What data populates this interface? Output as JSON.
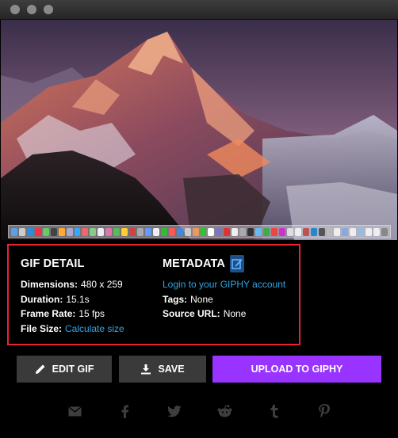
{
  "window": {
    "title": ""
  },
  "gif_detail": {
    "title": "GIF DETAIL",
    "dimensions_label": "Dimensions:",
    "dimensions_value": "480 x 259",
    "duration_label": "Duration:",
    "duration_value": "15.1s",
    "frame_rate_label": "Frame Rate:",
    "frame_rate_value": "15 fps",
    "file_size_label": "File Size:",
    "file_size_link": "Calculate size"
  },
  "metadata": {
    "title": "METADATA",
    "edit_icon": "edit-icon",
    "login_link": "Login to your GIPHY account",
    "tags_label": "Tags:",
    "tags_value": "None",
    "source_label": "Source URL:",
    "source_value": "None"
  },
  "actions": {
    "edit_label": "EDIT GIF",
    "save_label": "SAVE",
    "upload_label": "UPLOAD TO GIPHY"
  },
  "share_icons": [
    "email-icon",
    "facebook-icon",
    "twitter-icon",
    "reddit-icon",
    "tumblr-icon",
    "pinterest-icon"
  ],
  "colors": {
    "accent_purple": "#9933ff",
    "link_blue": "#2fa7e6",
    "highlight_red": "#e8232e"
  }
}
